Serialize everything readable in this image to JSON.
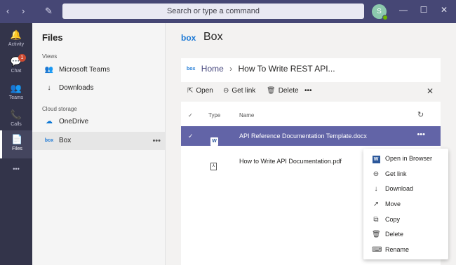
{
  "titlebar": {
    "search_placeholder": "Search or type a command",
    "back_glyph": "‹",
    "forward_glyph": "›",
    "compose_glyph": "✎",
    "avatar_initial": "S",
    "minimize_glyph": "—",
    "maximize_glyph": "☐",
    "close_glyph": "✕",
    "colors": {
      "bar": "#464775",
      "search_bg": "#e9e9f3"
    }
  },
  "rail": {
    "items": [
      {
        "label": "Activity",
        "icon": "bell-icon",
        "glyph": "🔔"
      },
      {
        "label": "Chat",
        "icon": "chat-icon",
        "glyph": "💬",
        "badge": "1"
      },
      {
        "label": "Teams",
        "icon": "teams-icon",
        "glyph": "👥"
      },
      {
        "label": "Calls",
        "icon": "phone-icon",
        "glyph": "📞"
      },
      {
        "label": "Files",
        "icon": "file-icon",
        "glyph": "📄",
        "active": true
      }
    ],
    "more_glyph": "•••"
  },
  "files_panel": {
    "title": "Files",
    "views_heading": "Views",
    "views": [
      {
        "label": "Microsoft Teams",
        "icon": "teams-logo-icon",
        "glyph": "👥"
      },
      {
        "label": "Downloads",
        "icon": "download-icon",
        "glyph": "↓"
      }
    ],
    "cloud_heading": "Cloud storage",
    "cloud": [
      {
        "label": "OneDrive",
        "icon": "onedrive-icon",
        "glyph": "☁"
      },
      {
        "label": "Box",
        "icon": "box-logo-icon",
        "glyph": "box",
        "selected": true
      }
    ],
    "more_glyph": "•••"
  },
  "main": {
    "logo_text": "box",
    "title": "Box",
    "breadcrumb": {
      "logo_text": "box",
      "home": "Home",
      "separator": "›",
      "current": "How To Write REST API..."
    },
    "toolbar": {
      "open": "Open",
      "get_link": "Get link",
      "delete": "Delete",
      "more": "•••",
      "close": "✕"
    },
    "table": {
      "headers": {
        "check": "✓",
        "type": "Type",
        "name": "Name",
        "refresh": "↻"
      },
      "rows": [
        {
          "check": "✓",
          "type_icon": "word-doc-icon",
          "type_glyph": "W",
          "name": "API Reference Documentation Template.docx",
          "more": "•••",
          "selected": true
        },
        {
          "check": "",
          "type_icon": "pdf-icon",
          "type_glyph": "⅄",
          "name": "How to Write API Documentation.pdf",
          "more": "",
          "selected": false
        }
      ]
    },
    "accent": "#6264a7"
  },
  "context_menu": {
    "items": [
      {
        "label": "Open in Browser",
        "icon": "word-icon",
        "glyph": "W"
      },
      {
        "label": "Get link",
        "icon": "link-icon",
        "glyph": "⊖"
      },
      {
        "label": "Download",
        "icon": "download-icon",
        "glyph": "↓"
      },
      {
        "label": "Move",
        "icon": "move-icon",
        "glyph": "↗"
      },
      {
        "label": "Copy",
        "icon": "copy-icon",
        "glyph": "⧉"
      },
      {
        "label": "Delete",
        "icon": "trash-icon",
        "glyph": "🗑"
      },
      {
        "label": "Rename",
        "icon": "rename-icon",
        "glyph": "⌨"
      }
    ]
  }
}
